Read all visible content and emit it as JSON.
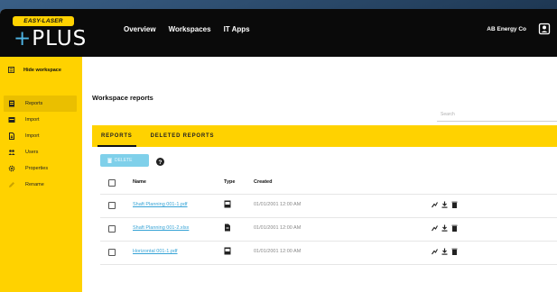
{
  "app": {
    "logo_badge": "EASY-LASER",
    "logo_word": "PLUS",
    "nav": [
      "Overview",
      "Workspaces",
      "IT Apps"
    ],
    "user": "AB Energy Co"
  },
  "sidebar": {
    "header": "Hide workspace",
    "items": [
      {
        "label": "Reports",
        "icon": "report-icon",
        "active": true
      },
      {
        "label": "Import",
        "icon": "import-icon"
      },
      {
        "label": "Import",
        "icon": "file-import-icon"
      },
      {
        "label": "Users",
        "icon": "users-icon"
      },
      {
        "label": "Properties",
        "icon": "gear-icon"
      },
      {
        "label": "Rename",
        "icon": "pencil-icon"
      }
    ]
  },
  "main": {
    "title": "Workspace reports",
    "search_placeholder": "Search",
    "tabs": [
      "REPORTS",
      "DELETED REPORTS"
    ],
    "delete_label": "DELETE",
    "columns": {
      "name": "Name",
      "type": "Type",
      "created": "Created"
    },
    "rows": [
      {
        "name": "Shaft Planning 001-1.pdf",
        "type_icon": "report-doc-icon",
        "created": "01/01/2001 12:00 AM"
      },
      {
        "name": "Shaft Planning 001-2.xlsx",
        "type_icon": "file-icon",
        "created": "01/01/2001 12:00 AM"
      },
      {
        "name": "Horizontal 001-1.pdf",
        "type_icon": "report-doc-icon",
        "created": "01/01/2001 12:00 AM"
      }
    ]
  },
  "colors": {
    "accent": "#ffd200",
    "topbar": "#0a0a0a",
    "link": "#36a3d6",
    "button": "#7fd0ea"
  }
}
